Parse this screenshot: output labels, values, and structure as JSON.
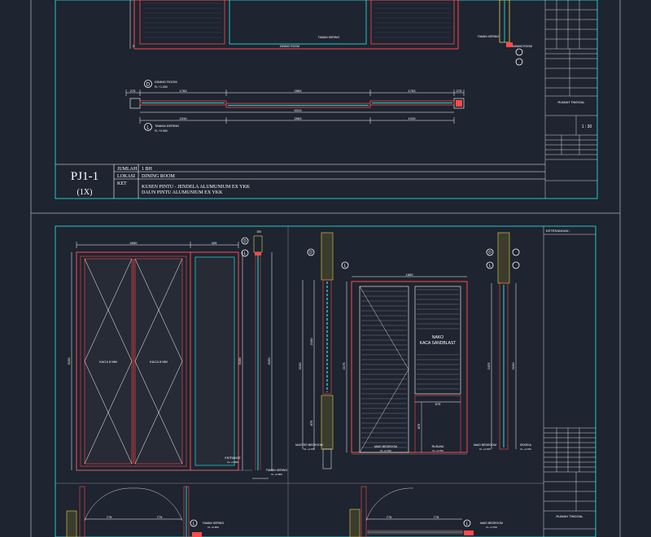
{
  "top_sheet": {
    "section_markers": {
      "d": "D",
      "l": "L"
    },
    "plan_labels": {
      "dining_room": "DINING ROOM",
      "dining_room_fl": "FL +1.000",
      "taman_kering": "TAMAN KERING",
      "taman_kering_fl": "FL +0.900"
    },
    "plan_dims_top": [
      "275",
      "1763",
      "2563",
      "1763",
      "275"
    ],
    "plan_dims_mid": "5313",
    "plan_dims_bot": [
      "1919",
      "2563",
      "1919"
    ],
    "elev_tags": [
      "TAMAN KERING",
      "DINING ROOM"
    ],
    "door_code": "PJ1-1",
    "door_qty": "(1X)",
    "info": [
      {
        "key": "JUMLAH",
        "value": "1 BH"
      },
      {
        "key": "LOKASI",
        "value": "DINING ROOM"
      },
      {
        "key": "KET",
        "value": "KUSEN PINTU - JENDELA ALUMUNIUM EX YKK"
      }
    ],
    "info_extra": "DAUN PINTU ALUMUNIUM EX YKK",
    "title_block": {
      "project": "RUMAH TINGGAL",
      "scale": "1 : 30"
    }
  },
  "bottom_sheet": {
    "keterangan": "KETERANGAN :",
    "left_elev": {
      "dim_top": [
        "4050",
        "425"
      ],
      "pane_labels": [
        "KACA 8 MM",
        "KACA 8 MM"
      ],
      "height_left": "3100",
      "height_right": "3100",
      "height_total": "3150",
      "entrance": "ENTRANCE",
      "entrance_fl": "FL +1.000",
      "taman_kering": "TAMAN KERING",
      "taman_kering_fl": "FL +0.900",
      "top_dim": "150",
      "plan_dims": [
        "775",
        "775"
      ],
      "plan_taman": "TAMAN KERING",
      "plan_taman_fl": "FL +0.900"
    },
    "right_elev": {
      "dim_top": "1650",
      "nako_label": "NAKO",
      "kaca_label": "KACA SANDBLAST",
      "dim_mid": "675",
      "dims_left": [
        "2150",
        "875"
      ],
      "dims_right": [
        "2425"
      ],
      "rooms": [
        {
          "name": "MASTER BEDROOM",
          "fl": "FL +4.700"
        },
        {
          "name": "MAID BEDROOM",
          "fl": "FL +4.700"
        },
        {
          "name": "RUSUNA",
          "fl": "FL +4.700"
        },
        {
          "name": "MAID BEDROOM",
          "fl": "FL +4.700"
        },
        {
          "name": "SEKEKA",
          "fl": "FL +4.700"
        }
      ],
      "plan_room": "MAID BEDROOM",
      "plan_room_fl": "FL +4.700"
    },
    "title_block": {
      "project": "RUMAH TINGGAL"
    }
  }
}
